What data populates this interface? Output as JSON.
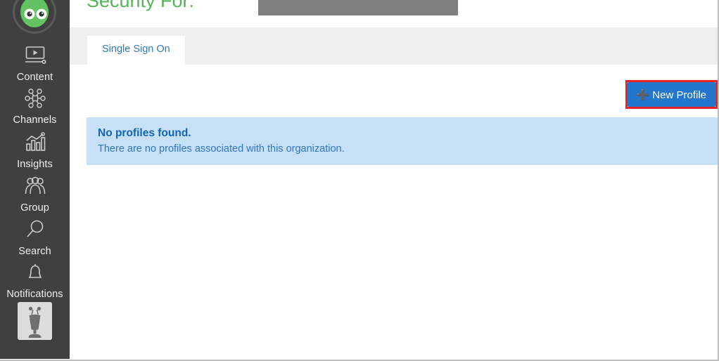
{
  "sidebar": {
    "logo": {
      "name": "green-alien-logo"
    },
    "items": [
      {
        "label": "Content",
        "icon": "video-player-icon"
      },
      {
        "label": "Channels",
        "icon": "channels-network-icon"
      },
      {
        "label": "Insights",
        "icon": "bar-chart-trend-icon"
      },
      {
        "label": "Group",
        "icon": "people-group-icon"
      },
      {
        "label": "Search",
        "icon": "magnifier-icon"
      },
      {
        "label": "Notifications",
        "icon": "bell-icon"
      }
    ],
    "avatar": {
      "name": "user-avatar-robot"
    }
  },
  "header": {
    "title": "Security For:",
    "redacted_value": ""
  },
  "tabs": [
    {
      "label": "Single Sign On",
      "active": true
    }
  ],
  "toolbar": {
    "new_profile_label": "New Profile",
    "new_profile_icon": "plus-icon",
    "highlight_color": "#ee2222",
    "button_color": "#2277cc"
  },
  "alert": {
    "title": "No profiles found.",
    "message": "There are no profiles associated with this organization.",
    "background": "#c5e0f7",
    "text_color": "#2f76c0"
  },
  "colors": {
    "sidebar_bg": "#404040",
    "title_green": "#57b35b",
    "tabstrip_bg": "#efefef",
    "tab_link": "#337ab7"
  }
}
